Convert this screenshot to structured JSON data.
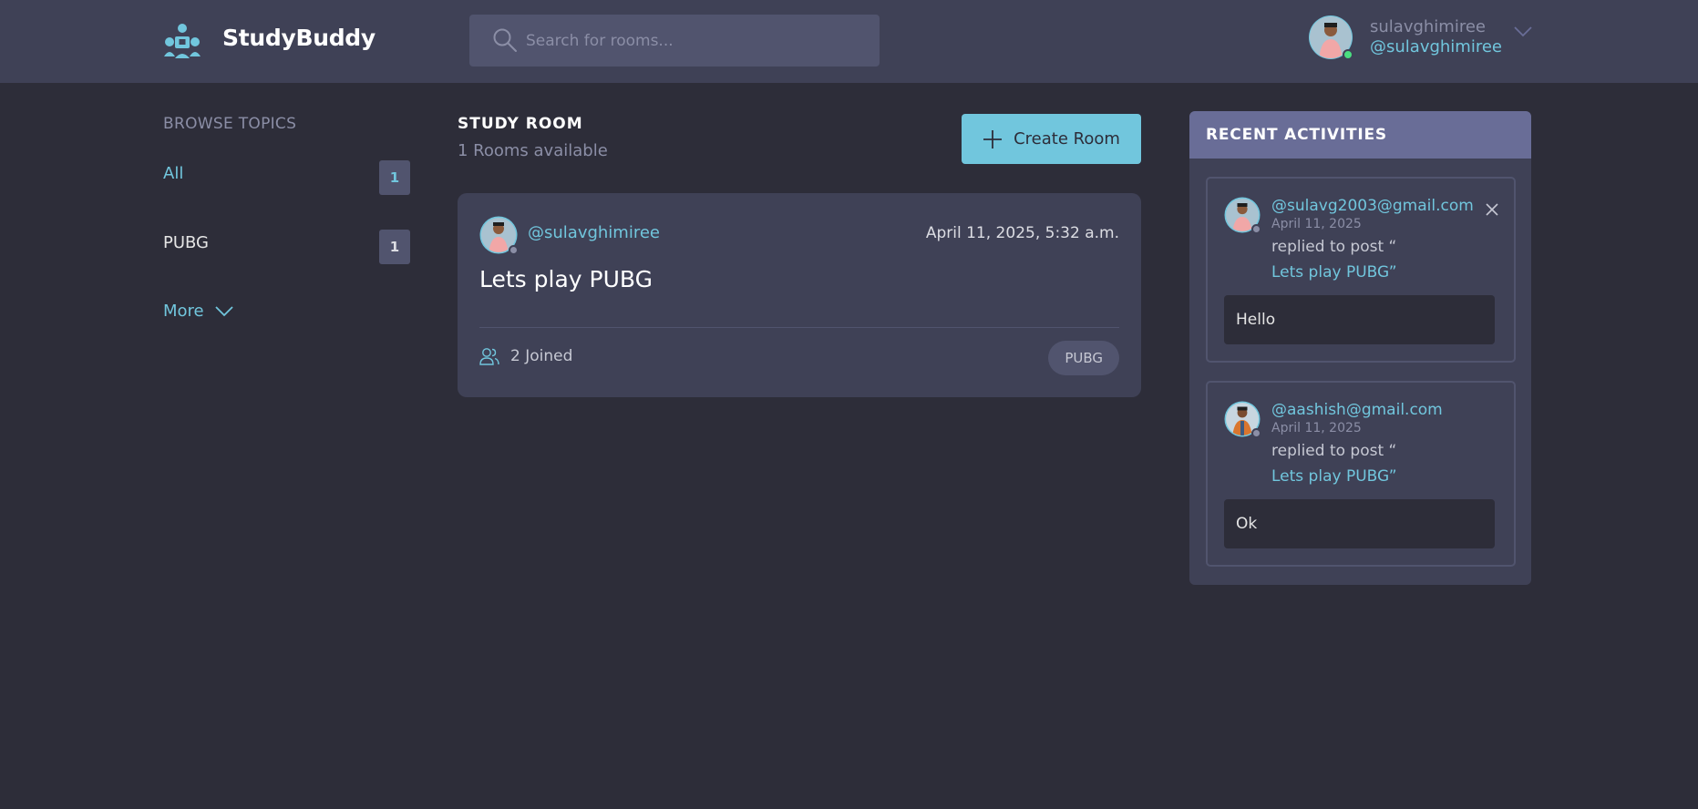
{
  "header": {
    "brand": "StudyBuddy",
    "search_placeholder": "Search for rooms...",
    "user": {
      "name": "sulavghimiree",
      "handle": "@sulavghimiree"
    }
  },
  "sidebar": {
    "title": "BROWSE TOPICS",
    "topics": [
      {
        "label": "All",
        "count": "1"
      },
      {
        "label": "PUBG",
        "count": "1"
      }
    ],
    "more_label": "More"
  },
  "main": {
    "heading": "STUDY ROOM",
    "rooms_available": "1 Rooms available",
    "create_label": "Create Room",
    "rooms": [
      {
        "host": "@sulavghimiree",
        "date": "April 11, 2025, 5:32 a.m.",
        "title": "Lets play PUBG",
        "joined": "2 Joined",
        "topic": "PUBG"
      }
    ]
  },
  "activities": {
    "title": "RECENT ACTIVITIES",
    "items": [
      {
        "user": "@sulavg2003@gmail.com",
        "date": "April 11, 2025",
        "action": "replied to post “",
        "post": "Lets play PUBG”",
        "message": "Hello"
      },
      {
        "user": "@aashish@gmail.com",
        "date": "April 11, 2025",
        "action": "replied to post “",
        "post": "Lets play PUBG”",
        "message": "Ok"
      }
    ]
  },
  "colors": {
    "accent": "#71c6dd",
    "background": "#2d2d39",
    "surface": "#3f4156",
    "online": "#4ade80",
    "offline": "#8b8ea6"
  }
}
